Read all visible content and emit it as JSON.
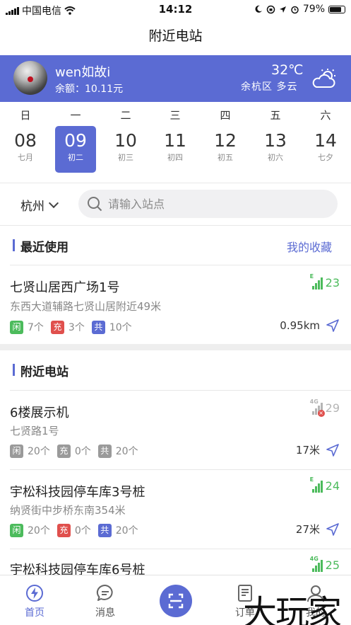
{
  "status_bar": {
    "carrier": "中国电信",
    "time": "14:12",
    "battery": "79%",
    "battery_level": 0.79
  },
  "nav": {
    "title": "附近电站"
  },
  "profile": {
    "username": "wen如故i",
    "balance": "余额：10.11元",
    "temperature": "32℃",
    "location_weather": "余杭区  多云",
    "weather_icon": "cloud-sun-icon"
  },
  "calendar": {
    "weekdays": [
      "日",
      "一",
      "二",
      "三",
      "四",
      "五",
      "六"
    ],
    "days": [
      {
        "num": "08",
        "lunar": "七月"
      },
      {
        "num": "09",
        "lunar": "初二"
      },
      {
        "num": "10",
        "lunar": "初三"
      },
      {
        "num": "11",
        "lunar": "初四"
      },
      {
        "num": "12",
        "lunar": "初五"
      },
      {
        "num": "13",
        "lunar": "初六"
      },
      {
        "num": "14",
        "lunar": "七夕"
      }
    ],
    "selected_index": 1
  },
  "filter": {
    "city": "杭州",
    "search_placeholder": "请输入站点"
  },
  "recent": {
    "title": "最近使用",
    "favorites_link": "我的收藏",
    "stations": [
      {
        "name": "七贤山居西广场1号",
        "address": "东西大道辅路七贤山居附近49米",
        "free": "7个",
        "charging": "3个",
        "shared": "10个",
        "free_tag": "闲",
        "charging_tag": "充",
        "shared_tag": "共",
        "distance": "0.95km",
        "network": "E",
        "signal": "23",
        "signal_color": "#4cbb5c",
        "online": true
      }
    ]
  },
  "nearby": {
    "title": "附近电站",
    "stations": [
      {
        "name": "6楼展示机",
        "address": "七贤路1号",
        "free": "20个",
        "charging": "0个",
        "shared": "20个",
        "free_tag": "闲",
        "charging_tag": "充",
        "shared_tag": "共",
        "distance": "17米",
        "network": "4G",
        "signal": "29",
        "signal_color": "#b5b5b5",
        "online": false
      },
      {
        "name": "宇松科技园停车库3号桩",
        "address": "纳贤街中步桥东南354米",
        "free": "20个",
        "charging": "0个",
        "shared": "20个",
        "free_tag": "闲",
        "charging_tag": "充",
        "shared_tag": "共",
        "distance": "27米",
        "network": "E",
        "signal": "24",
        "signal_color": "#4cbb5c",
        "online": true
      },
      {
        "name": "宇松科技园停车库6号桩",
        "network": "4G",
        "signal": "25",
        "signal_color": "#4cbb5c",
        "online": true
      }
    ]
  },
  "tabbar": {
    "tabs": [
      {
        "label": "首页",
        "icon": "home-bolt-icon",
        "active": true
      },
      {
        "label": "消息",
        "icon": "message-icon",
        "active": false
      },
      {
        "label": "",
        "icon": "scan-icon",
        "active": false
      },
      {
        "label": "订单",
        "icon": "order-icon",
        "active": false
      },
      {
        "label": "我的",
        "icon": "user-icon",
        "active": false
      }
    ]
  },
  "watermark": "大玩家",
  "colors": {
    "accent": "#5b6bd3",
    "free": "#4cbb5c",
    "charging": "#e0504d",
    "shared": "#5b6bd3"
  }
}
